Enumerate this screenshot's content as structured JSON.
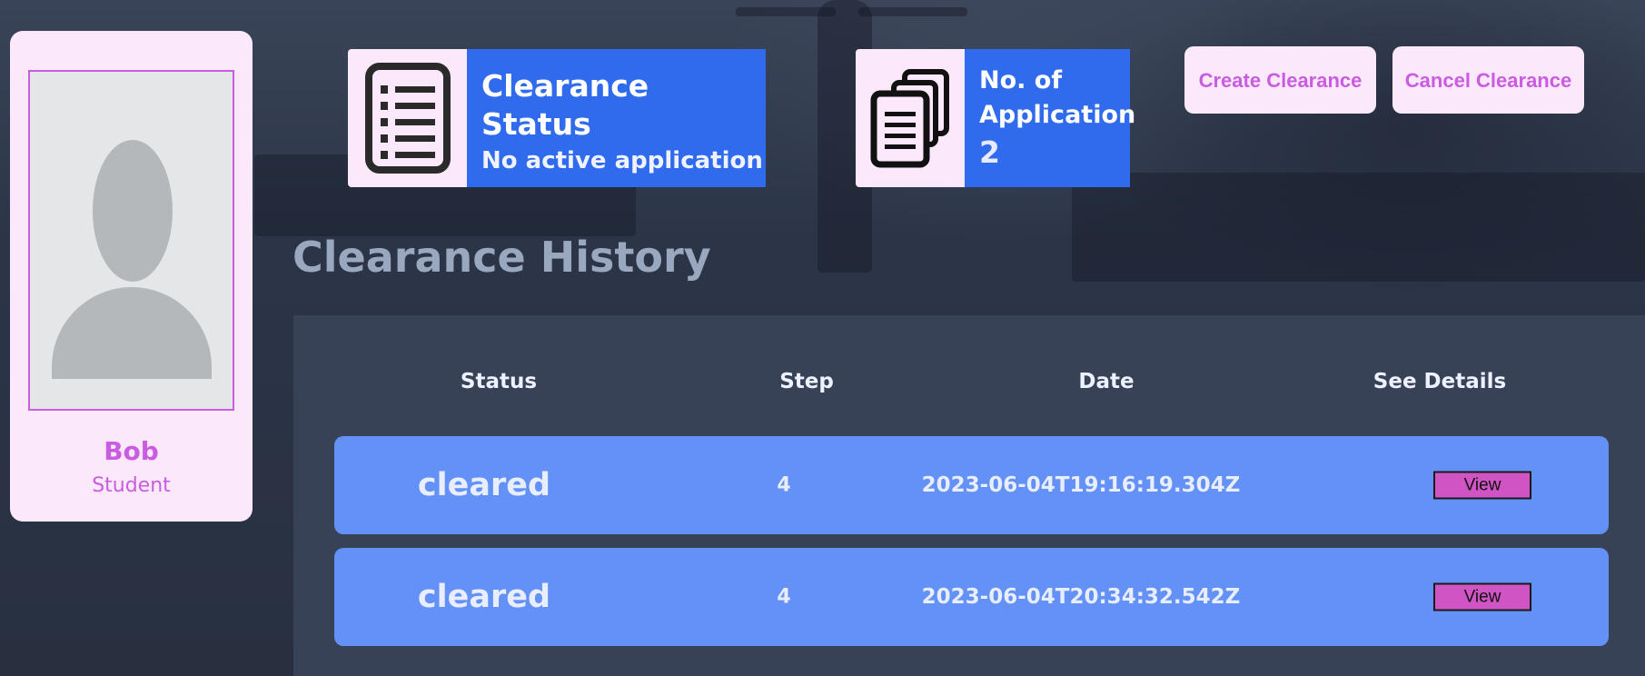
{
  "profile": {
    "name": "Bob",
    "role": "Student"
  },
  "stats": {
    "clearance_status": {
      "title": "Clearance Status",
      "value": "No active application",
      "icon": "list-icon"
    },
    "applications": {
      "title": "No. of Application",
      "value": "2",
      "icon": "documents-icon"
    }
  },
  "actions": {
    "create": "Create Clearance",
    "cancel": "Cancel Clearance"
  },
  "history": {
    "title": "Clearance History",
    "columns": [
      "Status",
      "Step",
      "Date",
      "See Details"
    ],
    "rows": [
      {
        "status": "cleared",
        "step": "4",
        "date": "2023-06-04T19:16:19.304Z",
        "action": "View"
      },
      {
        "status": "cleared",
        "step": "4",
        "date": "2023-06-04T20:34:32.542Z",
        "action": "View"
      }
    ]
  },
  "colors": {
    "accent": "#c95ce0",
    "card_bg": "#fbe8fb",
    "stat_blue": "#2f6bec",
    "row_blue": "#6391f5",
    "view_button": "#d154c4"
  }
}
